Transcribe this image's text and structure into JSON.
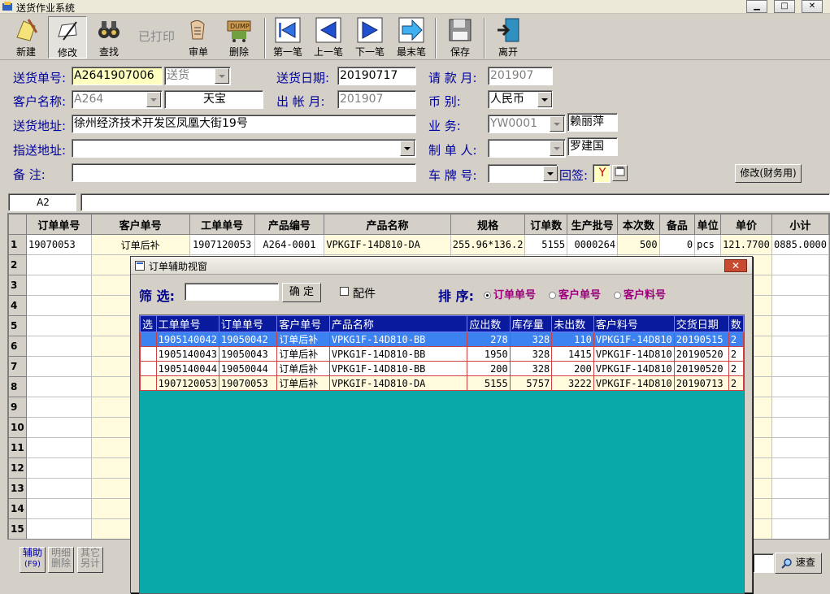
{
  "window": {
    "title": "送货作业系统"
  },
  "toolbar": {
    "new": "新建",
    "edit": "修改",
    "find": "查找",
    "printed": "已打印",
    "review": "审单",
    "delete": "删除",
    "first": "第一笔",
    "prev": "上一笔",
    "next": "下一笔",
    "last": "最末笔",
    "save": "保存",
    "exit": "离开"
  },
  "form": {
    "delivery_no_label": "送货单号:",
    "delivery_no": "A2641907006",
    "delivery_type": "送货",
    "delivery_date_label": "送货日期:",
    "delivery_date": "20190717",
    "request_month_label": "请 款 月:",
    "request_month": "201907",
    "customer_label": "客户名称:",
    "customer_code": "A264",
    "customer_name": "天宝",
    "account_month_label": "出 帐 月:",
    "account_month": "201907",
    "currency_label": "币    别:",
    "currency": "人民币",
    "address_label": "送货地址:",
    "address": "徐州经济技术开发区凤凰大街19号",
    "sales_label": "业    务:",
    "sales_code": "YW0001",
    "sales_name": "赖丽萍",
    "ship_to_label": "指送地址:",
    "ship_to": "",
    "maker_label": "制 单 人:",
    "maker_code": "",
    "maker_name": "罗建国",
    "remark_label": "备    注:",
    "remark": "",
    "plate_label": "车 牌 号:",
    "plate": "",
    "receipt_label": "回签:",
    "receipt": "Y",
    "edit_finance": "修改(财务用)"
  },
  "cellbar": {
    "ref": "A2",
    "value": ""
  },
  "grid": {
    "columns": [
      "",
      "订单单号",
      "客户单号",
      "工单单号",
      "产品编号",
      "产品名称",
      "规格",
      "订单数",
      "生产批号",
      "本次数",
      "备品",
      "单位",
      "单价",
      "小计"
    ],
    "rows": [
      {
        "n": "1",
        "order": "19070053",
        "cust": "订单后补",
        "wo": "1907120053",
        "pcode": "A264-0001",
        "pname": "VPKGIF-14D810-DA",
        "spec": "255.96*136.2",
        "qty": "5155",
        "lot": "0000264",
        "cur": "500",
        "spare": "0",
        "unit": "pcs",
        "price": "121.7700",
        "sub": "0885.0000"
      },
      {
        "n": "2"
      },
      {
        "n": "3"
      },
      {
        "n": "4"
      },
      {
        "n": "5"
      },
      {
        "n": "6"
      },
      {
        "n": "7"
      },
      {
        "n": "8"
      },
      {
        "n": "9"
      },
      {
        "n": "10"
      },
      {
        "n": "11"
      },
      {
        "n": "12"
      },
      {
        "n": "13"
      },
      {
        "n": "14"
      },
      {
        "n": "15"
      }
    ]
  },
  "bottom": {
    "assist": "辅助",
    "assist_key": "(F9)",
    "detail": "明细",
    "detail2": "删除",
    "other": "其它",
    "other2": "另计",
    "quick": "速查"
  },
  "dialog": {
    "title": "订单辅助视窗",
    "filter_label": "筛 选:",
    "filter_value": "",
    "confirm": "确 定",
    "parts": "配件",
    "sort_label": "排 序:",
    "sort_options": [
      "订单单号",
      "客户单号",
      "客户料号"
    ],
    "columns": [
      "选",
      "工单单号",
      "订单单号",
      "客户单号",
      "产品名称",
      "应出数",
      "库存量",
      "未出数",
      "客户料号",
      "交货日期",
      "数"
    ],
    "rows": [
      {
        "wo": "1905140042",
        "order": "19050042",
        "cust": "订单后补",
        "pname": "VPKG1F-14D810-BB",
        "due": "278",
        "stock": "328",
        "remain": "110",
        "cpart": "VPKG1F-14D810",
        "date": "20190515",
        "x": "2"
      },
      {
        "wo": "1905140043",
        "order": "19050043",
        "cust": "订单后补",
        "pname": "VPKG1F-14D810-BB",
        "due": "1950",
        "stock": "328",
        "remain": "1415",
        "cpart": "VPKG1F-14D810",
        "date": "20190520",
        "x": "2"
      },
      {
        "wo": "1905140044",
        "order": "19050044",
        "cust": "订单后补",
        "pname": "VPKG1F-14D810-BB",
        "due": "200",
        "stock": "328",
        "remain": "200",
        "cpart": "VPKG1F-14D810",
        "date": "20190520",
        "x": "2"
      },
      {
        "wo": "1907120053",
        "order": "19070053",
        "cust": "订单后补",
        "pname": "VPKGIF-14D810-DA",
        "due": "5155",
        "stock": "5757",
        "remain": "3222",
        "cpart": "VPKGIF-14D810",
        "date": "20190713",
        "x": "2"
      }
    ]
  }
}
